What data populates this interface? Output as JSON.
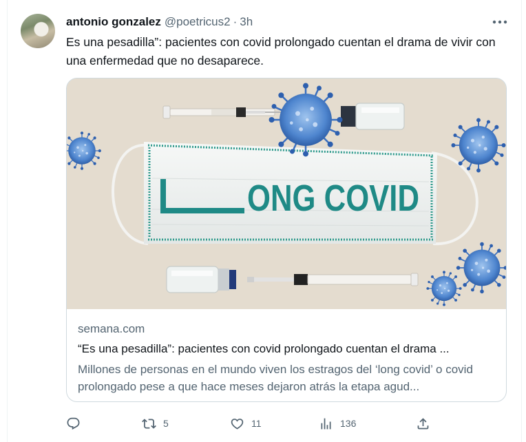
{
  "tweet": {
    "author_name": "antonio gonzalez",
    "handle": "@poetricus2",
    "separator": "·",
    "time": "3h",
    "text": "Es una pesadilla”: pacientes con covid prolongado cuentan el drama de vivir con una enfermedad que no desaparece."
  },
  "card": {
    "image_text": "ONG COVID",
    "domain": "semana.com",
    "title": "“Es una pesadilla”: pacientes con covid prolongado cuentan el drama ...",
    "description": "Millones de personas en el mundo viven los estragos del ‘long covid’ o covid prolongado pese a que hace meses dejaron atrás la etapa agud..."
  },
  "actions": {
    "reply_count": "",
    "retweet_count": "5",
    "like_count": "11",
    "views_count": "136"
  },
  "icons": [
    "more-icon",
    "reply-icon",
    "retweet-icon",
    "like-icon",
    "views-icon",
    "share-icon"
  ],
  "colors": {
    "text": "#0f1419",
    "secondary": "#536471",
    "border": "#cfd9de",
    "image_teal": "#1f8a86"
  }
}
